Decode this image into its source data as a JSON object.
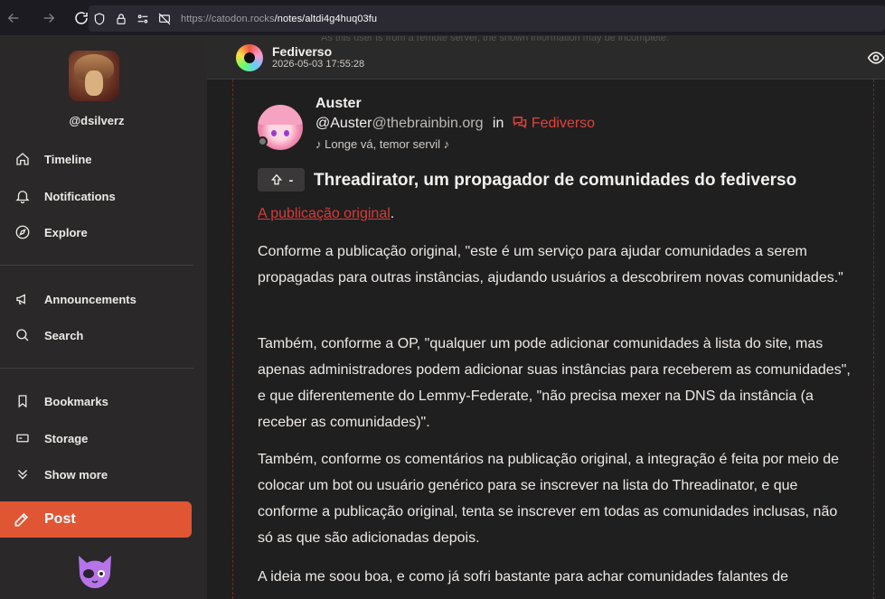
{
  "browser": {
    "url_host": "https://catodon.rocks",
    "url_path": "/notes/altdi4g4huq03fu"
  },
  "sidebar": {
    "handle": "@dsilverz",
    "items": [
      {
        "label": "Timeline",
        "icon": "home-icon"
      },
      {
        "label": "Notifications",
        "icon": "bell-icon"
      },
      {
        "label": "Explore",
        "icon": "compass-icon"
      },
      {
        "label": "Announcements",
        "icon": "megaphone-icon"
      },
      {
        "label": "Search",
        "icon": "search-icon"
      },
      {
        "label": "Bookmarks",
        "icon": "bookmark-icon"
      },
      {
        "label": "Storage",
        "icon": "drive-icon"
      },
      {
        "label": "Show more",
        "icon": "chevrons-down-icon"
      }
    ],
    "post_label": "Post"
  },
  "note": {
    "header": {
      "channel_name": "Fediverso",
      "timestamp": "2026-05-03 17:55:28",
      "faded_notice": "As this user is from a remote server, the shown information may be incomplete."
    },
    "author": {
      "name": "Auster",
      "username": "@Auster",
      "host": "@thebrainbin.org",
      "in_label": "in",
      "channel": "Fediverso",
      "bio": "♪ Longe vá, temor servil ♪"
    },
    "badge_label": "-",
    "title": "Threadirator, um propagador de comunidades do fediverso",
    "link_text": "A publicação original",
    "link_suffix": ".",
    "paragraphs": [
      "Conforme a publicação original, \"este é um serviço para ajudar comunidades a serem propagadas para outras instâncias, ajudando usuários a descobrirem novas comunidades.\"",
      "Também, conforme a OP, \"qualquer um pode adicionar comunidades à lista do site, mas apenas administradores podem adicionar suas instâncias para receberem as comunidades\", e que diferentemente do Lemmy-Federate, \"não precisa mexer na DNS da instância (a receber as comunidades)\".",
      "Também, conforme os comentários na publicação original, a integração é feita por meio de colocar um bot ou usuário genérico para se inscrever na lista do Threadinator, e que conforme a publicação original, tenta se inscrever em todas as comunidades inclusas, não só as que são adicionadas depois.",
      "A ideia me soou boa, e como já sofri bastante para achar comunidades falantes de"
    ]
  },
  "colors": {
    "accent": "#e05634",
    "link": "#d73a3a",
    "background": "#201f1f",
    "sidebar": "#2a2829"
  }
}
